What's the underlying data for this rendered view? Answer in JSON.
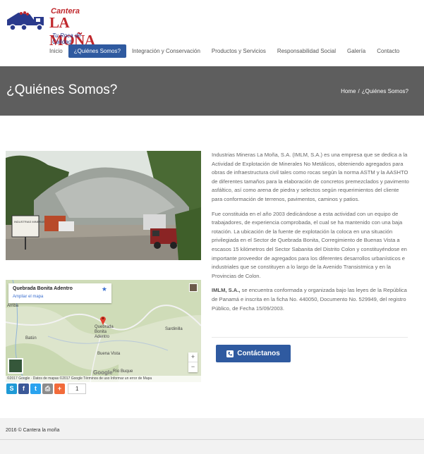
{
  "logo": {
    "line1": "Cantera",
    "line2": "LA MOÑA",
    "tagline": "Tu Roca de Calidad"
  },
  "nav": {
    "items": [
      "Inicio",
      "¿Quiénes Somos?",
      "Integración y Conservación",
      "Productos y Servicios",
      "Responsabilidad Social",
      "Galería",
      "Contacto"
    ],
    "active_index": 1
  },
  "banner": {
    "title": "¿Quiénes Somos?",
    "crumb_home": "Home",
    "crumb_sep": "/",
    "crumb_current": "¿Quiénes Somos?"
  },
  "photo": {
    "sign_text": "INDUSTRIAS MINERAS LA MOÑA"
  },
  "map": {
    "place_title": "Quebrada Bonita Adentro",
    "enlarge_link": "Ampliar el mapa",
    "labels": {
      "arriba": "Arriba",
      "pin_label": "Quebrada Bonita Adentro",
      "sardinilla": "Sardinilla",
      "batun": "Batún",
      "buena_vista": "Buena Vista",
      "rio_buque": "Río Buque"
    },
    "google": "Google",
    "footer": "©2017 Google · Datos de mapas ©2017 Google   Términos de uso   Informar un error de Mapa",
    "zoom_in": "+",
    "zoom_out": "−"
  },
  "share": {
    "count": "1",
    "icons": [
      "skype-icon",
      "facebook-icon",
      "twitter-icon",
      "print-icon",
      "plus-icon"
    ]
  },
  "content": {
    "p1": "Industrias Mineras La Moña, S.A. (IMLM, S.A.) es una empresa que se dedica a la Actividad de Explotación de Minerales No Metálicos, obteniendo agregados para obras de infraestructura civil tales como rocas según la norma ASTM y la  AASHTO de diferentes tamaños para la elaboración de concretos premezclados y pavimento asfáltico, así como arena de piedra y selectos según requerimientos del cliente para conformación de terrenos, pavimentos, caminos y patios.",
    "p2": "Fue constituida en el año 2003 dedicándose a esta actividad con un equipo de trabajadores, de experiencia comprobada, el cual se ha mantenido con una baja rotación. La ubicación de la fuente de explotación la coloca en una situación privilegiada en el Sector de Quebrada Bonita, Corregimiento de Buenas Vista a escasos 15 kilómetros del Sector Sabanita del Distrito Colon y constituyéndose en importante proveedor de agregados para los diferentes desarrollos urbanísticos e industriales que se constituyen a lo largo de la Avenido Transistmica y en la Provincias de Colon.",
    "p3_bold": "IMLM, S.A.,",
    "p3_rest": " se encuentra conformada y organizada bajo las leyes de la República de Panamá e inscrita en la ficha No. 440050, Documento No. 529949, del registro Público, de Fecha 15/09/2003."
  },
  "button": {
    "label": "Contáctanos"
  },
  "footer": {
    "copyright": "2016 © Cantera la moña"
  },
  "colors": {
    "accent": "#2f5aa0",
    "banner": "#5e5e5e",
    "logo_red": "#c0282d"
  }
}
